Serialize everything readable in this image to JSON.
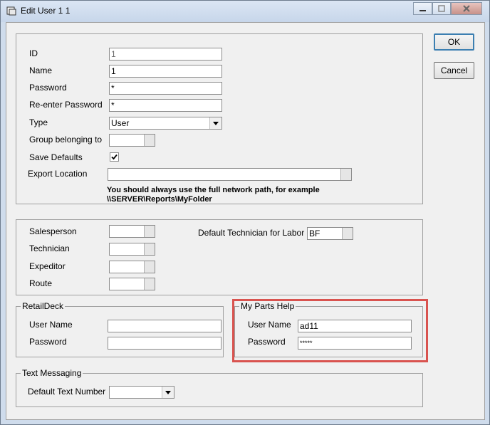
{
  "window": {
    "title": "Edit User 1 1"
  },
  "buttons": {
    "ok": "OK",
    "cancel": "Cancel"
  },
  "user": {
    "id_label": "ID",
    "id_value": "1",
    "name_label": "Name",
    "name_value": "1",
    "password_label": "Password",
    "password_value": "*",
    "reenter_label": "Re-enter Password",
    "reenter_value": "*",
    "type_label": "Type",
    "type_value": "User",
    "group_label": "Group belonging to",
    "group_value": "",
    "save_defaults_label": "Save Defaults",
    "save_defaults_checked": true,
    "export_label": "Export Location",
    "export_value": "",
    "note_line1": "You should always use the full network path, for example",
    "note_line2": "\\\\SERVER\\Reports\\MyFolder"
  },
  "roles": {
    "salesperson_label": "Salesperson",
    "technician_label": "Technician",
    "expeditor_label": "Expeditor",
    "route_label": "Route",
    "default_tech_label": "Default Technician for Labor",
    "default_tech_value": "BF"
  },
  "retaildeck": {
    "legend": "RetailDeck",
    "username_label": "User Name",
    "username_value": "",
    "password_label": "Password",
    "password_value": ""
  },
  "myparts": {
    "legend": "My Parts Help",
    "username_label": "User Name",
    "username_value": "ad11",
    "password_label": "Password",
    "password_value": "*****"
  },
  "text_messaging": {
    "legend": "Text Messaging",
    "default_number_label": "Default Text Number",
    "default_number_value": ""
  },
  "colors": {
    "highlight": "#d9534f",
    "window_frame": "#cfdcec",
    "client_bg": "#f0f0f0"
  }
}
